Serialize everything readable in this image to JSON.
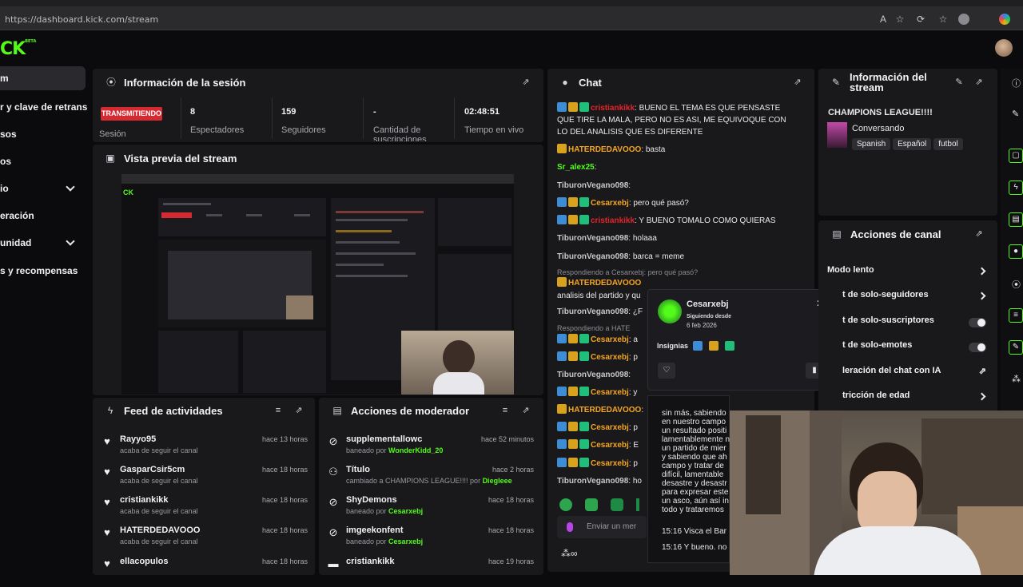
{
  "browser": {
    "url": "https://dashboard.kick.com/stream"
  },
  "app": {
    "logo": "CK",
    "logo_beta": "BETA"
  },
  "sidebar": {
    "items": [
      {
        "label": "m",
        "active": true
      },
      {
        "label": "r y clave de retransm"
      },
      {
        "label": "sos"
      },
      {
        "label": "os"
      },
      {
        "label": "io",
        "chevron": true
      },
      {
        "label": "eración"
      },
      {
        "label": "unidad",
        "chevron": true
      },
      {
        "label": "s y recompensas"
      }
    ]
  },
  "session": {
    "title": "Información de la sesión",
    "status_badge": "TRANSMITIENDO",
    "status_label": "Sesión",
    "stats": [
      {
        "value": "8",
        "label": "Espectadores"
      },
      {
        "value": "159",
        "label": "Seguidores"
      },
      {
        "value": "-",
        "label": "Cantidad de suscripciones"
      },
      {
        "value": "02:48:51",
        "label": "Tiempo en vivo"
      }
    ]
  },
  "preview": {
    "title": "Vista previa del stream"
  },
  "feed": {
    "title": "Feed de actividades",
    "items": [
      {
        "name": "Rayyo95",
        "sub": "acaba de seguir el canal",
        "time": "hace 13 horas"
      },
      {
        "name": "GasparCsir5cm",
        "sub": "acaba de seguir el canal",
        "time": "hace 18 horas"
      },
      {
        "name": "cristiankikk",
        "sub": "acaba de seguir el canal",
        "time": "hace 18 horas"
      },
      {
        "name": "HATERDEDAVOOO",
        "sub": "acaba de seguir el canal",
        "time": "hace 18 horas"
      },
      {
        "name": "ellacopulos",
        "sub": "",
        "time": "hace 18 horas"
      }
    ]
  },
  "mod": {
    "title": "Acciones de moderador",
    "items": [
      {
        "name": "supplementallowc",
        "sub_prefix": "baneado por ",
        "sub_user": "WonderKidd_20",
        "sub_mid": "",
        "sub_user2": "",
        "time": "hace 52 minutos"
      },
      {
        "name": "Título",
        "sub_prefix": "cambiado a ",
        "sub_user": "",
        "sub_mid": "CHAMPIONS LEAGUE!!!! por ",
        "sub_user2": "Diegleee",
        "time": "hace 2 horas"
      },
      {
        "name": "ShyDemons",
        "sub_prefix": "baneado por ",
        "sub_user": "Cesarxebj",
        "sub_mid": "",
        "sub_user2": "",
        "time": "hace 18 horas"
      },
      {
        "name": "imgeekonfent",
        "sub_prefix": "baneado por ",
        "sub_user": "Cesarxebj",
        "sub_mid": "",
        "sub_user2": "",
        "time": "hace 18 horas"
      },
      {
        "name": "cristiankikk",
        "sub_prefix": "",
        "sub_user": "",
        "sub_mid": "",
        "sub_user2": "",
        "time": "hace 19 horas"
      }
    ]
  },
  "chat": {
    "title": "Chat",
    "messages": [
      {
        "user": "cristiankikk",
        "color": "red",
        "badges": [
          "blue",
          "gold",
          "green"
        ],
        "text": ": BUENO EL TEMA ES QUE PENSASTE QUE TIRE LA MALA, PERO NO ES ASI, ME EQUIVOQUE CON LO DEL ANALISIS QUE ES DIFERENTE"
      },
      {
        "user": "HATERDEDAVOOO",
        "color": "orange",
        "badges": [
          "gold"
        ],
        "text": ": basta"
      },
      {
        "user": "Sr_alex25",
        "color": "green",
        "badges": [],
        "text": ":"
      },
      {
        "user": "TiburonVegano098",
        "color": "gray",
        "badges": [],
        "text": ":"
      },
      {
        "user": "Cesarxebj",
        "color": "orange",
        "badges": [
          "blue",
          "gold",
          "green"
        ],
        "text": ": pero qué pasó?"
      },
      {
        "user": "cristiankikk",
        "color": "red",
        "badges": [
          "blue",
          "gold",
          "green"
        ],
        "text": ": Y BUENO TOMALO COMO QUIERAS"
      },
      {
        "user": "TiburonVegano098",
        "color": "gray",
        "badges": [],
        "text": ": holaaa"
      },
      {
        "user": "TiburonVegano098",
        "color": "gray",
        "badges": [],
        "text": ": barca = meme"
      },
      {
        "user": "HATERDEDAVOOO",
        "color": "orange",
        "badges": [
          "gold"
        ],
        "text": ""
      },
      {
        "user": "TiburonVegano098",
        "color": "gray",
        "badges": [],
        "text": ": ¿F"
      },
      {
        "user": "Cesarxebj",
        "color": "orange",
        "badges": [
          "blue",
          "gold",
          "green"
        ],
        "text": ": a"
      },
      {
        "user": "Cesarxebj",
        "color": "orange",
        "badges": [
          "blue",
          "gold",
          "green"
        ],
        "text": ": p"
      },
      {
        "user": "TiburonVegano098",
        "color": "gray",
        "badges": [],
        "text": ":"
      },
      {
        "user": "Cesarxebj",
        "color": "orange",
        "badges": [
          "blue",
          "gold",
          "green"
        ],
        "text": ": y"
      },
      {
        "user": "HATERDEDAVOOO",
        "color": "orange",
        "badges": [
          "gold"
        ],
        "text": ":"
      },
      {
        "user": "Cesarxebj",
        "color": "orange",
        "badges": [
          "blue",
          "gold",
          "green"
        ],
        "text": ": p"
      },
      {
        "user": "Cesarxebj",
        "color": "orange",
        "badges": [
          "blue",
          "gold",
          "green"
        ],
        "text": ": E"
      },
      {
        "user": "Cesarxebj",
        "color": "orange",
        "badges": [
          "blue",
          "gold",
          "green"
        ],
        "text": ": p"
      },
      {
        "user": "TiburonVegano098",
        "color": "gray",
        "badges": [],
        "text": ": ho"
      }
    ],
    "reply1": "Respondiendo a Cesarxebj: pero qué pasó?",
    "reply1_extra": "analisis del partido y qu",
    "reply2": "Respondiendo a HATE",
    "input_placeholder": "Enviar un mer"
  },
  "userpopup": {
    "name": "Cesarxebj",
    "following_label": "Siguiendo desde",
    "following_date": "6 feb 2026",
    "insignias_label": "Insignias"
  },
  "streaminfo": {
    "title": "Información del stream",
    "stream_title": "CHAMPIONS LEAGUE!!!!",
    "category": "Conversando",
    "tags": [
      "Spanish",
      "Español",
      "futbol"
    ]
  },
  "channel_actions": {
    "title": "Acciones de canal",
    "items": [
      {
        "label": "Modo lento",
        "control": "arrow"
      },
      {
        "label": "t de solo-seguidores",
        "control": "arrow"
      },
      {
        "label": "t de solo-suscriptores",
        "control": "toggle"
      },
      {
        "label": "t de solo-emotes",
        "control": "toggle"
      },
      {
        "label": "leración del chat con IA",
        "control": "external"
      },
      {
        "label": "tricción de edad",
        "control": "arrow"
      }
    ]
  },
  "webcam_text": {
    "lines": [
      "sin más, sabiendo",
      "en nuestro campo",
      "un resultado positi",
      "lamentablemente n",
      "un partido de mier",
      "y sabiendo que ah",
      "campo y tratar de",
      "difícil, lamentable",
      "desastre y desastr",
      "para expresar este",
      "un asco, aún así in",
      "todo y trataremos"
    ],
    "msg1": "15:16 Visca el Bar",
    "msg2": "15:16 Y bueno. no"
  },
  "colors": {
    "accent": "#53fc18",
    "live": "#d62a33",
    "panel": "#19191c",
    "bg": "#0b0b0d"
  },
  "icons": [
    "broadcast-icon",
    "chat-icon",
    "wrench-icon",
    "pencil-icon",
    "popout-icon",
    "filter-icon",
    "heart-icon",
    "ban-icon",
    "users-icon",
    "lightning-icon",
    "close-icon"
  ]
}
